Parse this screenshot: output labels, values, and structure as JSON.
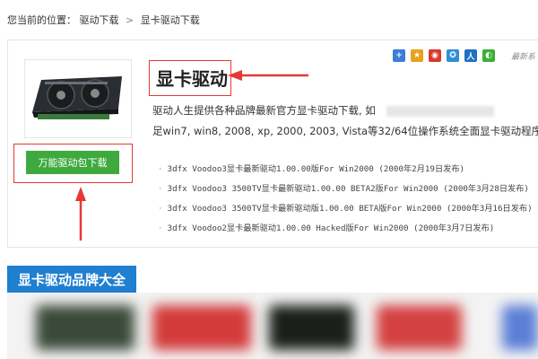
{
  "breadcrumb": {
    "label": "您当前的位置：",
    "items": [
      "驱动下载",
      "显卡驱动下载"
    ],
    "separator": ">"
  },
  "product": {
    "title": "显卡驱动",
    "desc_line1": "驱动人生提供各种品牌最新官方显卡驱动下载, 如",
    "desc_line2": "足win7, win8, 2008, xp, 2000, 2003, Vista等32/64位操作系统全面显卡驱动程序",
    "download_button": "万能驱动包下载"
  },
  "share": {
    "icons": [
      "plus-share-icon",
      "star-icon",
      "weibo-icon",
      "qq-zone-icon",
      "renren-icon",
      "wechat-icon"
    ],
    "more_label": "最新系"
  },
  "drivers": [
    "3dfx Voodoo3显卡最新驱动1.00.00版For Win2000 (2000年2月19日发布)",
    "3dfx Voodoo3 3500TV显卡最新驱动1.00.00 BETA2版For Win2000 (2000年3月28日发布)",
    "3dfx Voodoo3 3500TV显卡最新驱动版1.00.00 BETA版For Win2000 (2000年3月16日发布)",
    "3dfx Voodoo2显卡最新驱动1.00.00 Hacked版For Win2000 (2000年3月7日发布)"
  ],
  "brands": {
    "title": "显卡驱动品牌大全"
  },
  "colors": {
    "accent_blue": "#1f7fd0",
    "download_green": "#3eaa3e",
    "annotation_red": "#e53935"
  }
}
